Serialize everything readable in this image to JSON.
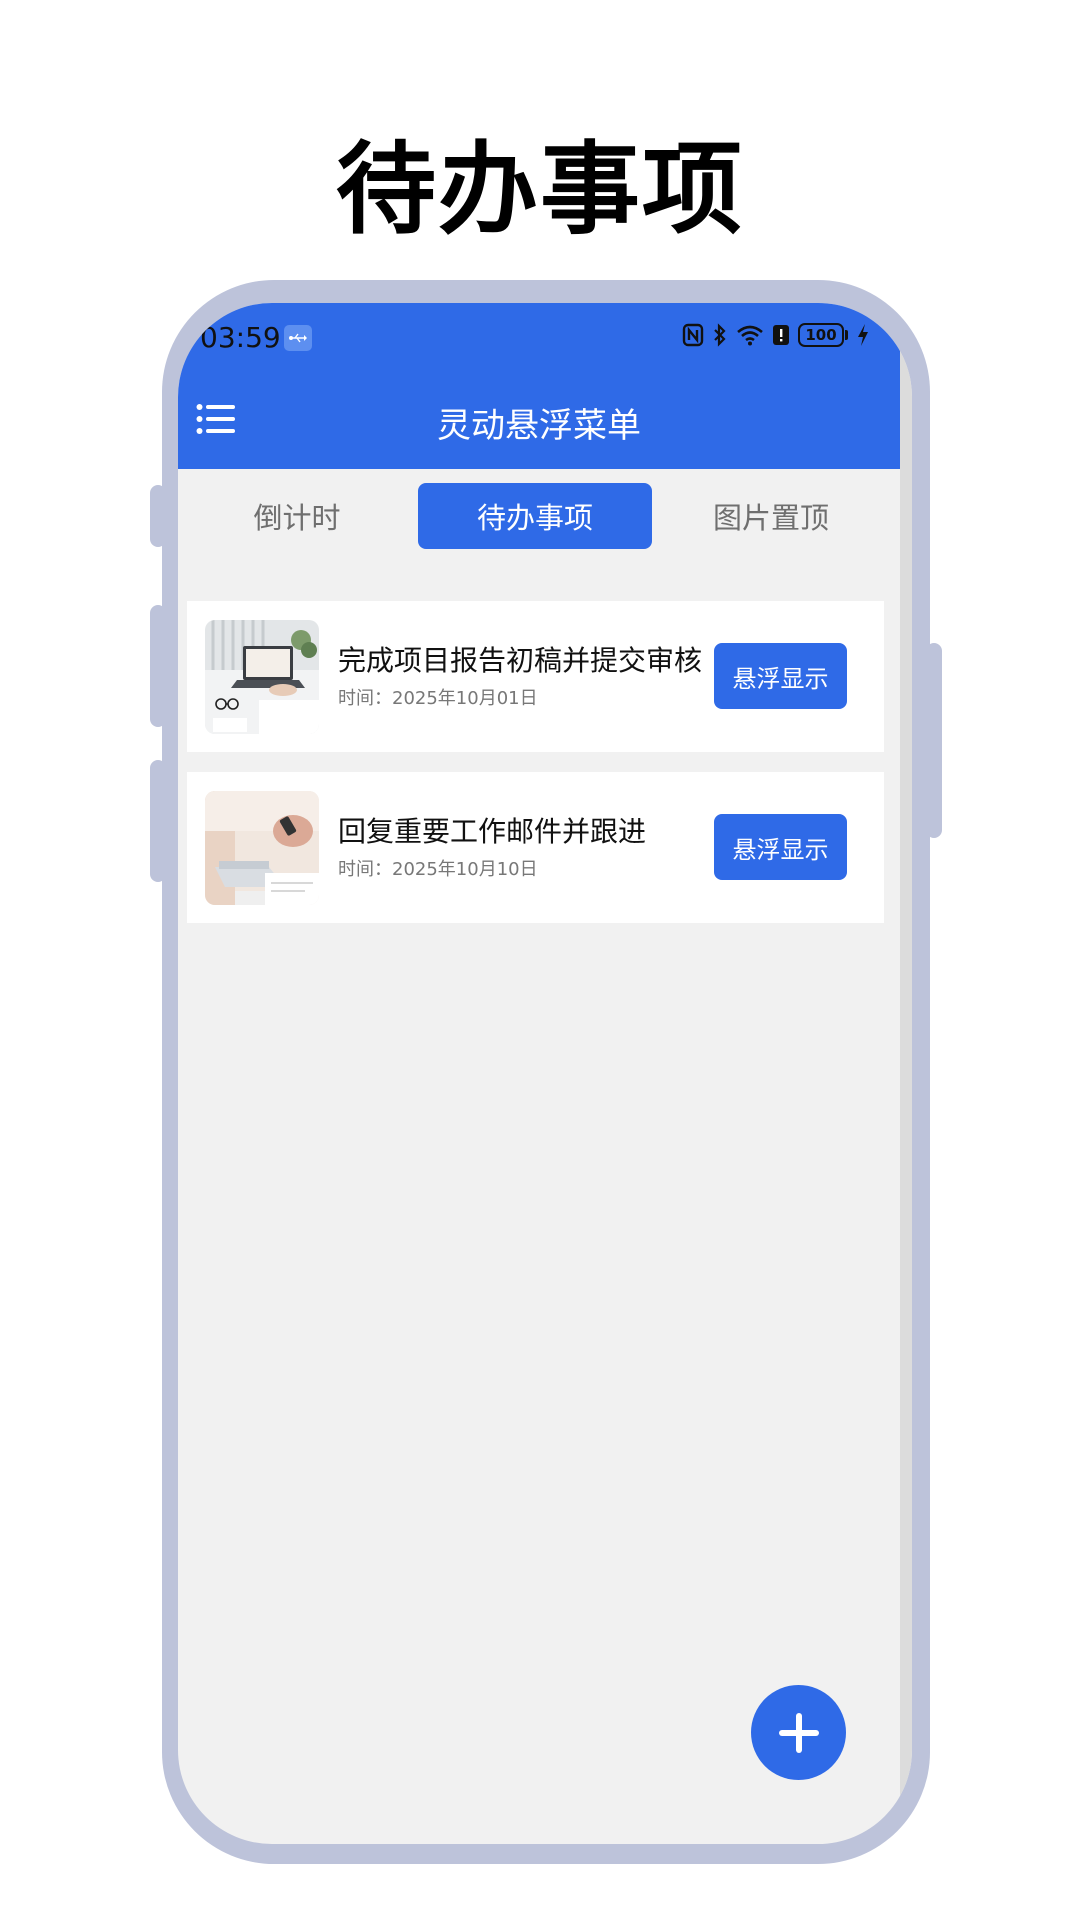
{
  "hero": {
    "title": "待办事项"
  },
  "status_bar": {
    "time": "03:59",
    "battery": "100",
    "icons": [
      "usb-icon",
      "nfc-icon",
      "bluetooth-icon",
      "wifi-icon",
      "alert-icon",
      "battery-icon",
      "charging-icon"
    ]
  },
  "appbar": {
    "title": "灵动悬浮菜单",
    "menu_icon": "menu-icon"
  },
  "tabs": [
    {
      "label": "倒计时",
      "active": false
    },
    {
      "label": "待办事项",
      "active": true
    },
    {
      "label": "图片置顶",
      "active": false
    }
  ],
  "items": [
    {
      "title": "完成项目报告初稿并提交审核",
      "time": "时间：2025年10月01日",
      "button": "悬浮显示",
      "image": "laptop-desk-photo"
    },
    {
      "title": "回复重要工作邮件并跟进",
      "time": "时间：2025年10月10日",
      "button": "悬浮显示",
      "image": "phone-laptop-photo"
    }
  ],
  "fab": {
    "icon": "plus-icon"
  },
  "colors": {
    "primary": "#2f6ae7",
    "frame": "#bdc3da",
    "background": "#f1f1f1"
  }
}
